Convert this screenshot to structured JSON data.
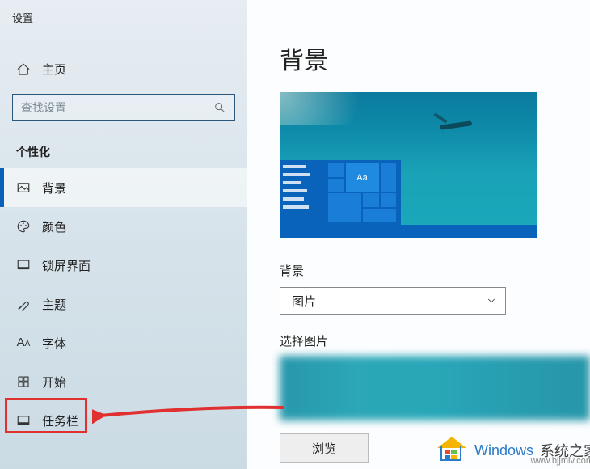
{
  "window": {
    "title": "设置"
  },
  "sidebar": {
    "home": "主页",
    "search_placeholder": "查找设置",
    "section": "个性化",
    "items": [
      {
        "label": "背景"
      },
      {
        "label": "颜色"
      },
      {
        "label": "锁屏界面"
      },
      {
        "label": "主题"
      },
      {
        "label": "字体"
      },
      {
        "label": "开始"
      },
      {
        "label": "任务栏"
      }
    ],
    "selected_index": 0,
    "highlighted_index": 6
  },
  "main": {
    "title": "背景",
    "preview_tile_text": "Aa",
    "bg_label": "背景",
    "bg_dropdown_value": "图片",
    "choose_label": "选择图片",
    "browse_label": "浏览"
  },
  "watermark": {
    "brand1": "Windows",
    "brand2": "系统之家",
    "url": "www.bjjmlv.com"
  }
}
